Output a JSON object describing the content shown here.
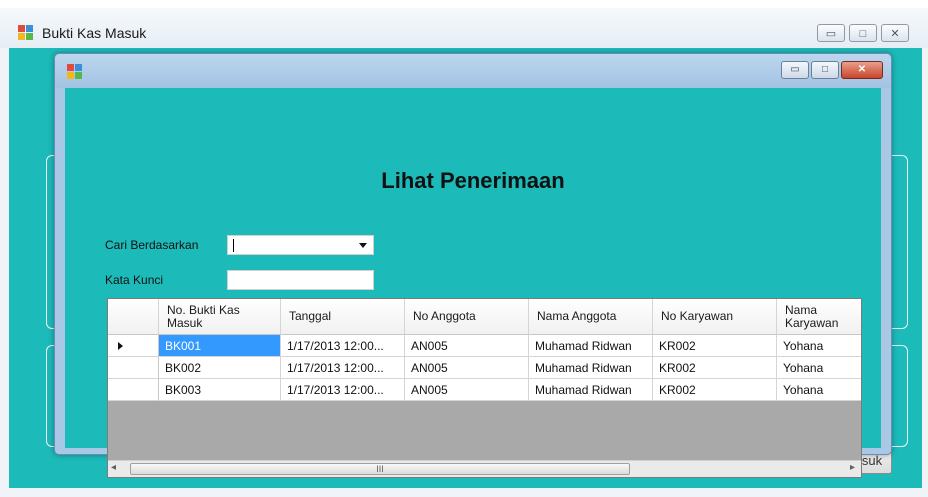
{
  "outer_window": {
    "title": "Bukti Kas Masuk",
    "caption_buttons": {
      "minimize": "▭",
      "maximize": "□",
      "close": "✕"
    },
    "background_button_label": "Kas Masuk"
  },
  "inner_window": {
    "caption_buttons": {
      "minimize": "▭",
      "maximize": "□",
      "close": "✕"
    },
    "heading": "Lihat Penerimaan",
    "filter": {
      "search_by_label": "Cari Berdasarkan",
      "search_by_value": "",
      "keyword_label": "Kata Kunci",
      "keyword_value": ""
    },
    "grid": {
      "columns": [
        "No. Bukti Kas Masuk",
        "Tanggal",
        "No Anggota",
        "Nama Anggota",
        "No Karyawan",
        "Nama Karyawan"
      ],
      "rows": [
        [
          "BK001",
          "1/17/2013 12:00...",
          "AN005",
          "Muhamad Ridwan",
          "KR002",
          "Yohana"
        ],
        [
          "BK002",
          "1/17/2013 12:00...",
          "AN005",
          "Muhamad Ridwan",
          "KR002",
          "Yohana"
        ],
        [
          "BK003",
          "1/17/2013 12:00...",
          "AN005",
          "Muhamad Ridwan",
          "KR002",
          "Yohana"
        ]
      ],
      "selected_row": 0,
      "scroll_left_arrow": "◂",
      "scroll_right_arrow": "▸",
      "scroll_grip": "III"
    }
  },
  "colors": {
    "form_background": "#1cbab9",
    "selection": "#3399ff",
    "grid_background": "#a9a9a9"
  }
}
